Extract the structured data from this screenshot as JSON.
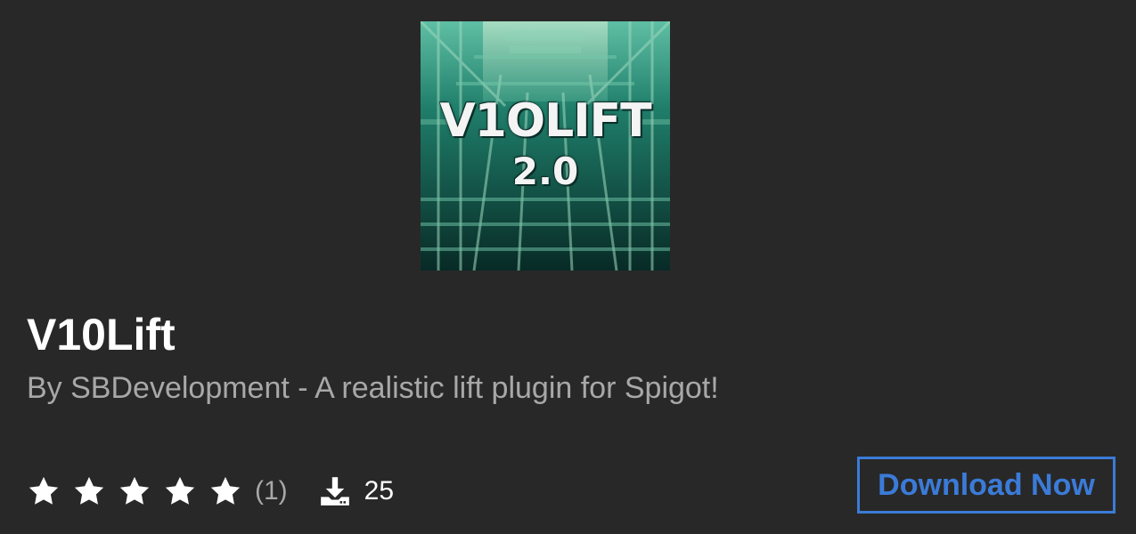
{
  "plugin": {
    "logo_title": "V1OLIFT",
    "logo_version": "2.0",
    "name": "V10Lift",
    "byline": "By SBDevelopment - A realistic lift plugin for Spigot!"
  },
  "stats": {
    "rating_stars": 5,
    "rating_count": "(1)",
    "downloads": "25"
  },
  "actions": {
    "download_label": "Download Now"
  },
  "colors": {
    "background": "#282828",
    "title": "#ffffff",
    "muted_text": "#a8a8a8",
    "accent": "#3b7bd8",
    "logo_green": "#2a9a83"
  },
  "icons": {
    "star": "star-icon",
    "download": "download-icon"
  }
}
